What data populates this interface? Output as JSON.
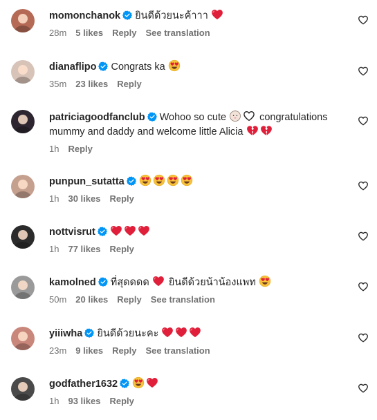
{
  "ui": {
    "reply_label": "Reply",
    "see_translation_label": "See translation"
  },
  "comments": [
    {
      "username": "momonchanok",
      "text": "ยินดีด้วยนะค้าาา",
      "emojis": [
        "red-heart"
      ],
      "time": "28m",
      "likes": "5 likes",
      "see_translation": true,
      "avatar_color": "#b56a55"
    },
    {
      "username": "dianaflipo",
      "text": "Congrats ka",
      "emojis": [
        "heart-eyes"
      ],
      "time": "35m",
      "likes": "23 likes",
      "see_translation": false,
      "avatar_color": "#d8c3b8"
    },
    {
      "username": "patriciagoodfanclub",
      "text": "Wohoo so cute",
      "text2": "congratulations",
      "line2": "mummy and daddy and welcome little Alicia",
      "time": "1h",
      "likes": "",
      "see_translation": false,
      "avatar_color": "#2d2530"
    },
    {
      "username": "punpun_sutatta",
      "text": "",
      "emojis": [
        "heart-eyes",
        "heart-eyes",
        "heart-eyes",
        "heart-eyes"
      ],
      "time": "1h",
      "likes": "30 likes",
      "see_translation": false,
      "avatar_color": "#c6a08f"
    },
    {
      "username": "nottvisrut",
      "text": "",
      "emojis": [
        "red-heart",
        "red-heart",
        "red-heart"
      ],
      "time": "1h",
      "likes": "77 likes",
      "see_translation": false,
      "avatar_color": "#2b2b2b"
    },
    {
      "username": "kamolned",
      "text": "ที่สุดดดด",
      "text2": "ยินดีด้วยน้าน้องแพท",
      "time": "50m",
      "likes": "20 likes",
      "see_translation": true,
      "avatar_color": "#9a9a9a"
    },
    {
      "username": "yiiiwha",
      "text": "ยินดีด้วยนะคะ",
      "emojis": [
        "red-heart",
        "red-heart",
        "red-heart"
      ],
      "time": "23m",
      "likes": "9 likes",
      "see_translation": true,
      "avatar_color": "#c9867a"
    },
    {
      "username": "godfather1632",
      "text": "",
      "emojis": [
        "heart-eyes",
        "red-heart"
      ],
      "time": "1h",
      "likes": "93 likes",
      "see_translation": false,
      "avatar_color": "#4a4a4a"
    }
  ],
  "colors": {
    "verified_blue": "#0095f6",
    "heart_red": "#e0203a",
    "meta_gray": "#737373"
  }
}
